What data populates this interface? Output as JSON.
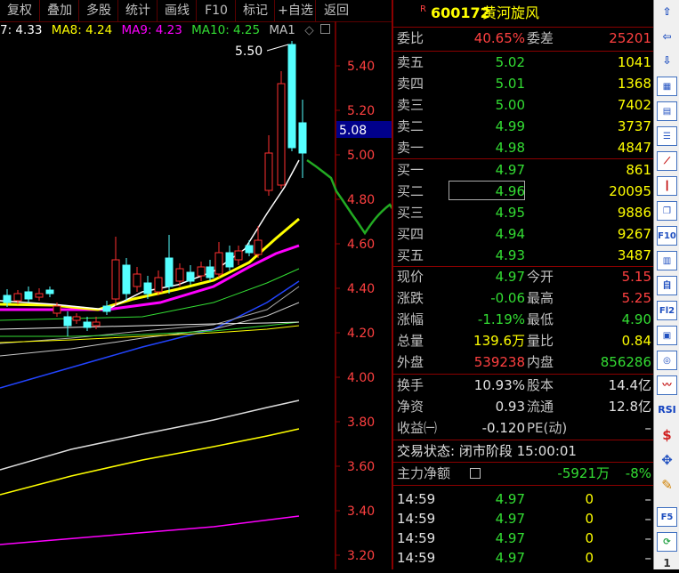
{
  "toolbar": {
    "prefix": "7",
    "buttons": [
      "复权",
      "叠加",
      "多股",
      "统计",
      "画线",
      "F10",
      "标记",
      "+自选",
      "返回"
    ]
  },
  "ma_line": {
    "ma7": ": 4.33",
    "ma8": "MA8: 4.24",
    "ma9": "MA9: 4.23",
    "ma10": "MA10: 4.25",
    "ma1": "MA1",
    "colors": {
      "ma7": "#ffffff",
      "ma8": "#ffff00",
      "ma9": "#ff00ff",
      "ma10": "#33dd33",
      "ma1": "#c0c0c0"
    }
  },
  "chart": {
    "price_ticks": [
      "5.40",
      "5.20",
      "5.00",
      "4.80",
      "4.60",
      "4.40",
      "4.20",
      "4.00",
      "3.80",
      "3.60",
      "3.40",
      "3.20"
    ],
    "high_label": "5.50",
    "current_price": "5.08"
  },
  "quote": {
    "badge": "R",
    "code": "600172",
    "name": "黄河旋风",
    "weibi_label": "委比",
    "weibi": "40.65%",
    "weicha_label": "委差",
    "weicha": "25201",
    "asks": [
      {
        "label": "卖五",
        "price": "5.02",
        "vol": "1041"
      },
      {
        "label": "卖四",
        "price": "5.01",
        "vol": "1368"
      },
      {
        "label": "卖三",
        "price": "5.00",
        "vol": "7402"
      },
      {
        "label": "卖二",
        "price": "4.99",
        "vol": "3737"
      },
      {
        "label": "卖一",
        "price": "4.98",
        "vol": "4847"
      }
    ],
    "bids": [
      {
        "label": "买一",
        "price": "4.97",
        "vol": "861"
      },
      {
        "label": "买二",
        "price": "4.96",
        "vol": "20095"
      },
      {
        "label": "买三",
        "price": "4.95",
        "vol": "9886"
      },
      {
        "label": "买四",
        "price": "4.94",
        "vol": "9267"
      },
      {
        "label": "买五",
        "price": "4.93",
        "vol": "3487"
      }
    ],
    "stats": [
      {
        "l1": "现价",
        "v1": "4.97",
        "c1": "green",
        "l2": "今开",
        "v2": "5.15",
        "c2": "red"
      },
      {
        "l1": "涨跌",
        "v1": "-0.06",
        "c1": "green",
        "l2": "最高",
        "v2": "5.25",
        "c2": "red"
      },
      {
        "l1": "涨幅",
        "v1": "-1.19%",
        "c1": "green",
        "l2": "最低",
        "v2": "4.90",
        "c2": "green"
      },
      {
        "l1": "总量",
        "v1": "139.6万",
        "c1": "yellow",
        "l2": "量比",
        "v2": "0.84",
        "c2": "yellow"
      },
      {
        "l1": "外盘",
        "v1": "539238",
        "c1": "red",
        "l2": "内盘",
        "v2": "856286",
        "c2": "green"
      }
    ],
    "fin": [
      {
        "l1": "换手",
        "v1": "10.93%",
        "l2": "股本",
        "v2": "14.4亿"
      },
      {
        "l1": "净资",
        "v1": "0.93",
        "l2": "流通",
        "v2": "12.8亿"
      },
      {
        "l1": "收益㈠",
        "v1": "-0.120",
        "l2": "PE(动)",
        "v2": "–"
      }
    ],
    "trade_status": "交易状态: 闭市阶段 15:00:01",
    "main_flow_label": "主力净额",
    "main_flow_value": "-5921万",
    "main_flow_pct": "-8%",
    "ticks": [
      {
        "time": "14:59",
        "price": "4.97",
        "vol": "0",
        "flag": "–"
      },
      {
        "time": "14:59",
        "price": "4.97",
        "vol": "0",
        "flag": "–"
      },
      {
        "time": "14:59",
        "price": "4.97",
        "vol": "0",
        "flag": "–"
      },
      {
        "time": "14:59",
        "price": "4.97",
        "vol": "0",
        "flag": "–"
      }
    ]
  },
  "side": {
    "icons": [
      "arrow-up-icon",
      "arrow-left-icon",
      "arrow-down-icon",
      "calendar-icon",
      "table-icon",
      "list-icon",
      "line-chart-icon",
      "candle-icon",
      "window-icon",
      "F10",
      "grid-icon",
      "自",
      "F12",
      "chart-icon",
      "target-icon",
      "trend-icon",
      "RSI",
      "dollar-icon",
      "move-icon",
      "pencil-icon",
      "F5",
      "refresh-icon",
      "1"
    ],
    "labels": {
      "f10": "F10",
      "zi": "自",
      "f12": "Fl2",
      "rsi": "RSI",
      "f5": "F5",
      "one": "1"
    }
  }
}
